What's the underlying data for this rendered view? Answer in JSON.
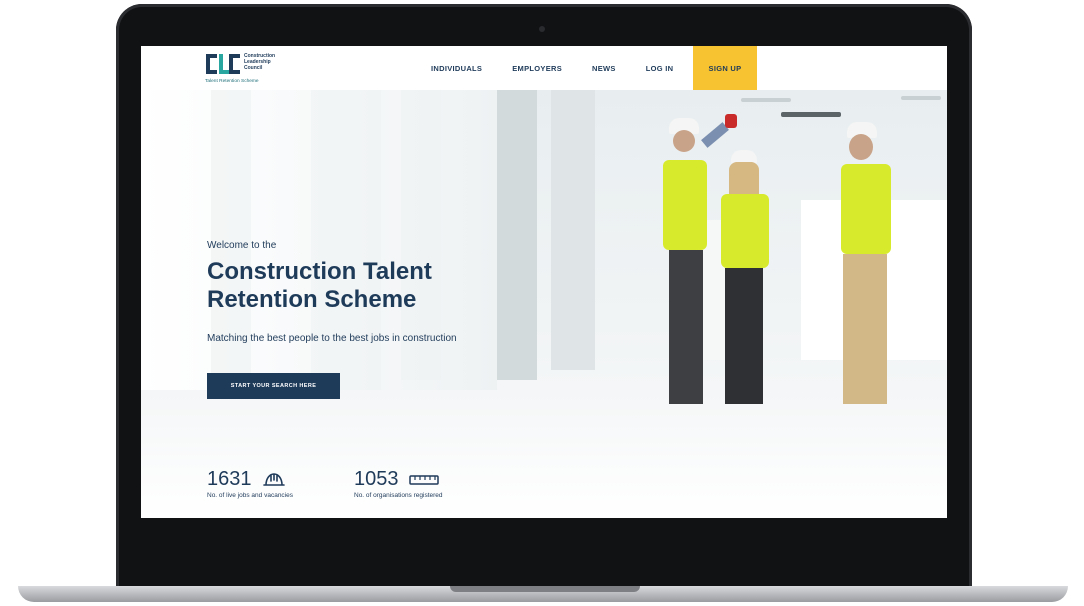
{
  "logo": {
    "name_line1": "Construction",
    "name_line2": "Leadership",
    "name_line3": "Council",
    "subtitle": "Talent Retention Scheme",
    "mark_color": "#1f3b5a",
    "accent_color": "#2aa6a0"
  },
  "nav": {
    "items": [
      {
        "label": "INDIVIDUALS"
      },
      {
        "label": "EMPLOYERS"
      },
      {
        "label": "NEWS"
      },
      {
        "label": "LOG IN"
      }
    ],
    "signup_label": "SIGN UP",
    "signup_color": "#f7c331"
  },
  "hero": {
    "welcome": "Welcome to the",
    "title": "Construction Talent Retention Scheme",
    "subtitle": "Matching the best people to the best jobs in construction",
    "cta_label": "START YOUR SEARCH HERE",
    "cta_color": "#1f3b5a"
  },
  "stats": [
    {
      "value": "1631",
      "label": "No. of live jobs and vacancies",
      "icon": "hard-hat-icon"
    },
    {
      "value": "1053",
      "label": "No. of organisations registered",
      "icon": "ruler-icon"
    }
  ]
}
